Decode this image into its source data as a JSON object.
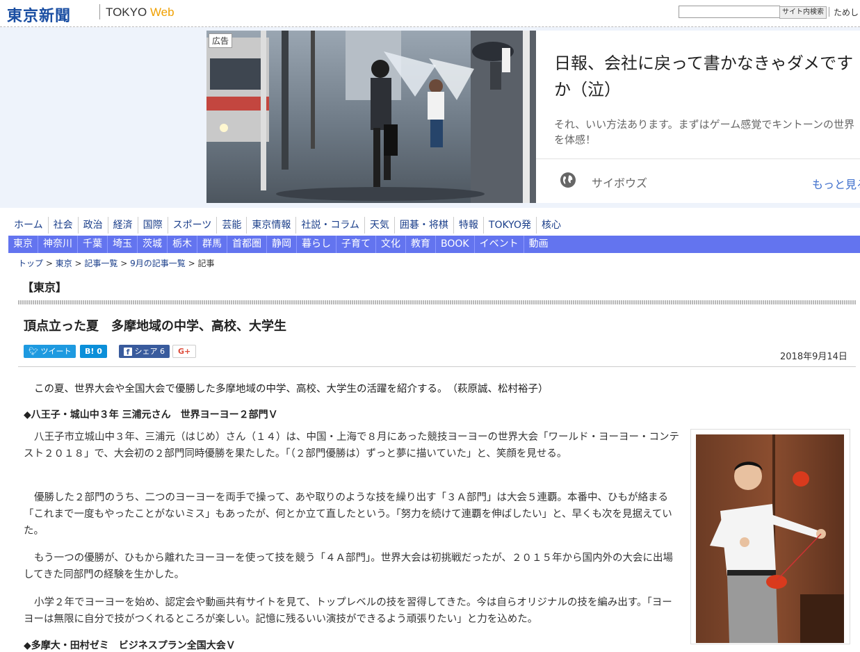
{
  "header": {
    "logo_text": "東京新聞",
    "logo_en_main": "TOKYO ",
    "logo_en_web": "Web",
    "search_placeholder": "",
    "search_button_label": "サイト内検索",
    "trial_link_label": "ためし"
  },
  "ad": {
    "label": "広告",
    "headline": "日報、会社に戻って書かなきゃダメですか（泣）",
    "description": "それ、いい方法あります。まずはゲーム感覚でキントーンの世界を体感！",
    "advertiser": "サイボウズ",
    "more_label": "もっと見る"
  },
  "nav_main": [
    "ホーム",
    "社会",
    "政治",
    "経済",
    "国際",
    "スポーツ",
    "芸能",
    "東京情報",
    "社説・コラム",
    "天気",
    "囲碁・将棋",
    "特報",
    "TOKYO発",
    "核心"
  ],
  "nav_regional": [
    "東京",
    "神奈川",
    "千葉",
    "埼玉",
    "茨城",
    "栃木",
    "群馬",
    "首都圏",
    "静岡",
    "暮らし",
    "子育て",
    "文化",
    "教育",
    "BOOK",
    "イベント",
    "動画"
  ],
  "breadcrumb": {
    "items": [
      "トップ",
      "東京",
      "記事一覧",
      "9月の記事一覧",
      "記事"
    ],
    "sep": " > "
  },
  "section_title": "【東京】",
  "article": {
    "headline": "頂点立った夏　多摩地域の中学、高校、大学生",
    "date": "2018年9月14日",
    "share": {
      "tweet": "ツイート",
      "hatena": "B! 0",
      "facebook": "シェア 6",
      "gplus": "G+"
    },
    "lead": "この夏、世界大会や全国大会で優勝した多摩地域の中学、高校、大学生の活躍を紹介する。　（萩原誠、松村裕子）",
    "subheading1": "◆八王子・城山中３年 三浦元さん　世界ヨーヨー２部門Ｖ",
    "paragraphs": [
      "八王子市立城山中３年、三浦元（はじめ）さん（１４）は、中国・上海で８月にあった競技ヨーヨーの世界大会「ワールド・ヨーヨー・コンテスト２０１８」で、大会初の２部門同時優勝を果たした。「（２部門優勝は）ずっと夢に描いていた」と、笑顔を見せる。",
      "優勝した２部門のうち、二つのヨーヨーを両手で操って、あや取りのような技を繰り出す「３Ａ部門」は大会５連覇。本番中、ひもが絡まる「これまで一度もやったことがないミス」もあったが、何とか立て直したという。「努力を続けて連覇を伸ばしたい」と、早くも次を見据えていた。",
      "もう一つの優勝が、ひもから離れたヨーヨーを使って技を競う「４Ａ部門」。世界大会は初挑戦だったが、２０１５年から国内外の大会に出場してきた同部門の経験を生かした。",
      "小学２年でヨーヨーを始め、認定会や動画共有サイトを見て、トップレベルの技を習得してきた。今は自らオリジナルの技を編み出す。「ヨーヨーは無限に自分で技がつくれるところが楽しい。記憶に残るいい演技ができるよう頑張りたい」と力を込めた。"
    ],
    "subheading2": "◆多摩大・田村ゼミ　ビジネスプラン全国大会Ｖ"
  },
  "colors": {
    "brand_blue": "#1a4ea2",
    "nav_regional_bg": "#6374ef",
    "web_orange": "#f0a000"
  }
}
